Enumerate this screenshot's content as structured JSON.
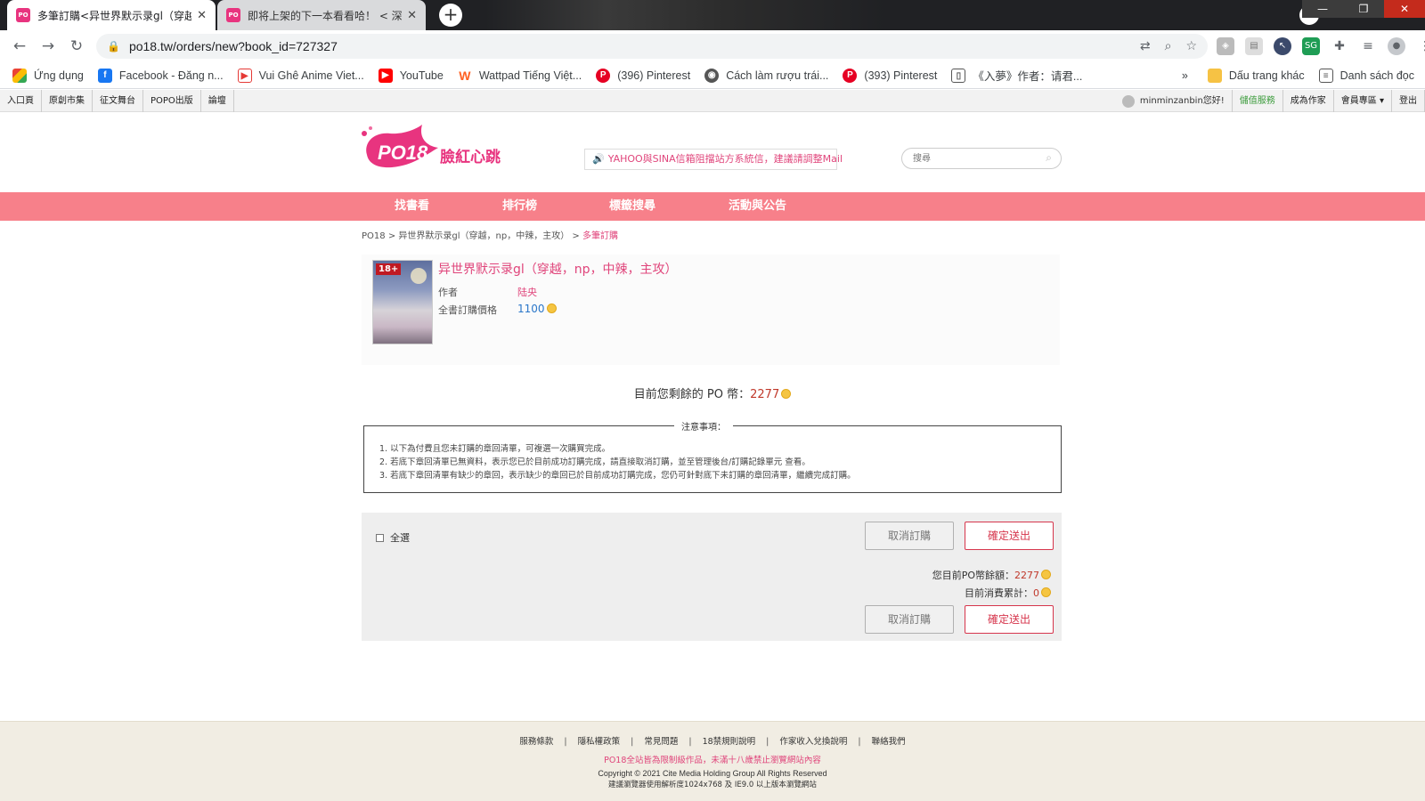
{
  "browser": {
    "tabs": [
      {
        "title": "多筆訂購<异世界默示录gl（穿越"
      },
      {
        "title": "即将上架的下一本看看哈！ < 深"
      }
    ],
    "url": "po18.tw/orders/new?book_id=727327",
    "bookmarks": [
      {
        "label": "Ứng dụng"
      },
      {
        "label": "Facebook - Đăng n..."
      },
      {
        "label": "Vui Ghê Anime Viet..."
      },
      {
        "label": "YouTube"
      },
      {
        "label": "Wattpad Tiếng Việt..."
      },
      {
        "label": "(396) Pinterest"
      },
      {
        "label": "Cách làm rượu trái..."
      },
      {
        "label": "(393) Pinterest"
      },
      {
        "label": "《入夢》作者：请君..."
      }
    ],
    "bookmarks_right": {
      "more": "»",
      "other": "Dấu trang khác",
      "reading": "Danh sách đọc"
    }
  },
  "utilbar": {
    "left": [
      "入口頁",
      "原創市集",
      "征文舞台",
      "POPO出版",
      "論壇"
    ],
    "member": "minminzanbin您好!",
    "right": [
      "儲值服務",
      "成為作家",
      "會員專區 ▾",
      "登出"
    ]
  },
  "header": {
    "logo_text": "PO18",
    "logo_sub": "臉紅心跳",
    "notice": "YAHOO與SINA信箱阻擋站方系統信，建議請調整Mail",
    "search_placeholder": "搜尋"
  },
  "nav": [
    "找書看",
    "排行榜",
    "標籤搜尋",
    "活動與公告"
  ],
  "breadcrumb": {
    "home": "PO18",
    "sep": " > ",
    "book": "异世界默示录gl（穿越，np，中辣，主攻）",
    "current": "多筆訂購"
  },
  "book": {
    "badge": "18+",
    "title": "异世界默示录gl（穿越，np，中辣，主攻）",
    "author_label": "作者",
    "author": "陆央",
    "price_label": "全書訂購價格",
    "price": "1100"
  },
  "balance": {
    "label": "目前您剩餘的 PO 幣：",
    "value": "2277"
  },
  "notes": {
    "legend": "注意事項：",
    "items": [
      "1. 以下為付費且您未訂購的章回清單，可複選一次購買完成。",
      "2. 若底下章回清單已無資料，表示您已於目前成功訂購完成，請直接取消訂購，並至管理後台/訂購記錄單元 查看。",
      "3. 若底下章回清單有缺少的章回，表示缺少的章回已於目前成功訂購完成，您仍可針對底下未訂購的章回清單，繼續完成訂購。"
    ]
  },
  "order": {
    "select_all": "全選",
    "cancel": "取消訂購",
    "confirm": "確定送出",
    "balance_label": "您目前PO幣餘額：",
    "balance_value": "2277",
    "spent_label": "目前消費累計：",
    "spent_value": "0"
  },
  "footer": {
    "links": [
      "服務條款",
      "隱私權政策",
      "常見問題",
      "18禁規則說明",
      "作家收入兌換說明",
      "聯絡我們"
    ],
    "warning": "PO18全站皆為限制級作品，未滿十八歲禁止瀏覽網站內容",
    "copyright": "Copyright © 2021 Cite Media Holding Group All Rights Reserved",
    "recommend": "建議瀏覽器使用解析度1024x768 及 IE9.0 以上版本瀏覽網站"
  },
  "colors": {
    "brand_pink": "#f7808a",
    "accent_pink": "#e0457b",
    "confirm_red": "#d6354c"
  }
}
